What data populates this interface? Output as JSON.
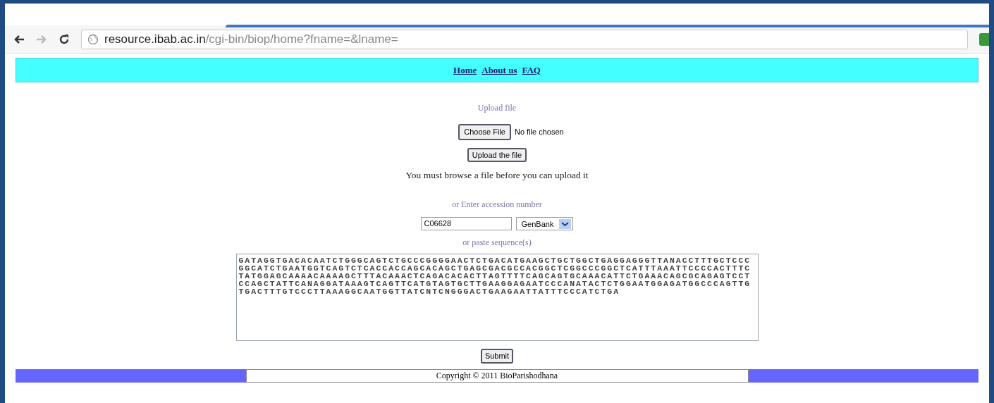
{
  "browser": {
    "url_host": "resource.ibab.ac.in",
    "url_path": "/cgi-bin/biop/home?fname=&lname="
  },
  "nav": [
    {
      "label": "Home"
    },
    {
      "label": "About us"
    },
    {
      "label": "FAQ"
    }
  ],
  "upload": {
    "heading": "Upload file",
    "choose_button": "Choose File",
    "file_status": "No file chosen",
    "upload_button": "Upload the file",
    "message": "You must browse a file before you can upload it"
  },
  "accession": {
    "heading": "or Enter accession number",
    "value": "C06628",
    "database": "GenBank"
  },
  "sequence": {
    "heading": "or paste sequence(s)",
    "lines": [
      "GATAGGTGACACAATCTGGGCAGTCTGCCCGGGGAACTCTGACATGAAGCTGCTGGCTGAGGAGGGTTANACCTTTGCTCCC",
      "GGCATCTGAATGGTCAGTCTCACCACCAGCACAGCTGAGCGACGCCACGGCTCGGCCCGGCTCATTTAAATTCCCCACTTTC",
      "TATGGAGCAAAACAAAAGCTTTACAAACTCAGACACACTTAGTTTTCAGCAGTGCAAACATTCTGAAACAGCGCAGAGTCCT",
      "CCAGCTATTCANAGGATAAAGTCAGTTCATGTAGTGCTTGAAGGAGAATCCCANATACTCTGGAATGGAGATGGCCCAGTTG",
      "TGACTTTGTCCCTTAAAGGCAATGGTTATCNTCNGGGACTGAAGAATTATTTCCCATCTGA"
    ]
  },
  "submit_button": "Submit",
  "footer": "Copyright © 2011 BioParishodhana"
}
